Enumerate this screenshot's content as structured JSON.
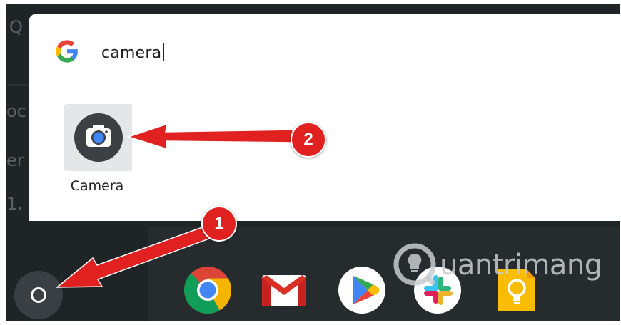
{
  "search": {
    "query": "camera",
    "provider_icon": "google-g-icon"
  },
  "results": [
    {
      "label": "Camera",
      "icon": "camera-app-icon"
    }
  ],
  "shelf": {
    "launcher_icon": "launcher-circle-icon",
    "apps": [
      {
        "name": "chrome",
        "icon": "chrome-icon"
      },
      {
        "name": "gmail",
        "icon": "gmail-icon"
      },
      {
        "name": "play-store",
        "icon": "play-store-icon"
      },
      {
        "name": "slack",
        "icon": "slack-icon"
      },
      {
        "name": "keep",
        "icon": "keep-icon"
      }
    ]
  },
  "annotations": {
    "badge_1": "1",
    "badge_2": "2",
    "color": "#e0211f"
  },
  "watermark": {
    "text": "uantrimang"
  },
  "colors": {
    "screen_bg": "#1f2427",
    "launcher_bg": "#ffffff",
    "google_blue": "#4285f4",
    "google_red": "#ea4335",
    "google_yellow": "#fbbc05",
    "google_green": "#34a853"
  }
}
